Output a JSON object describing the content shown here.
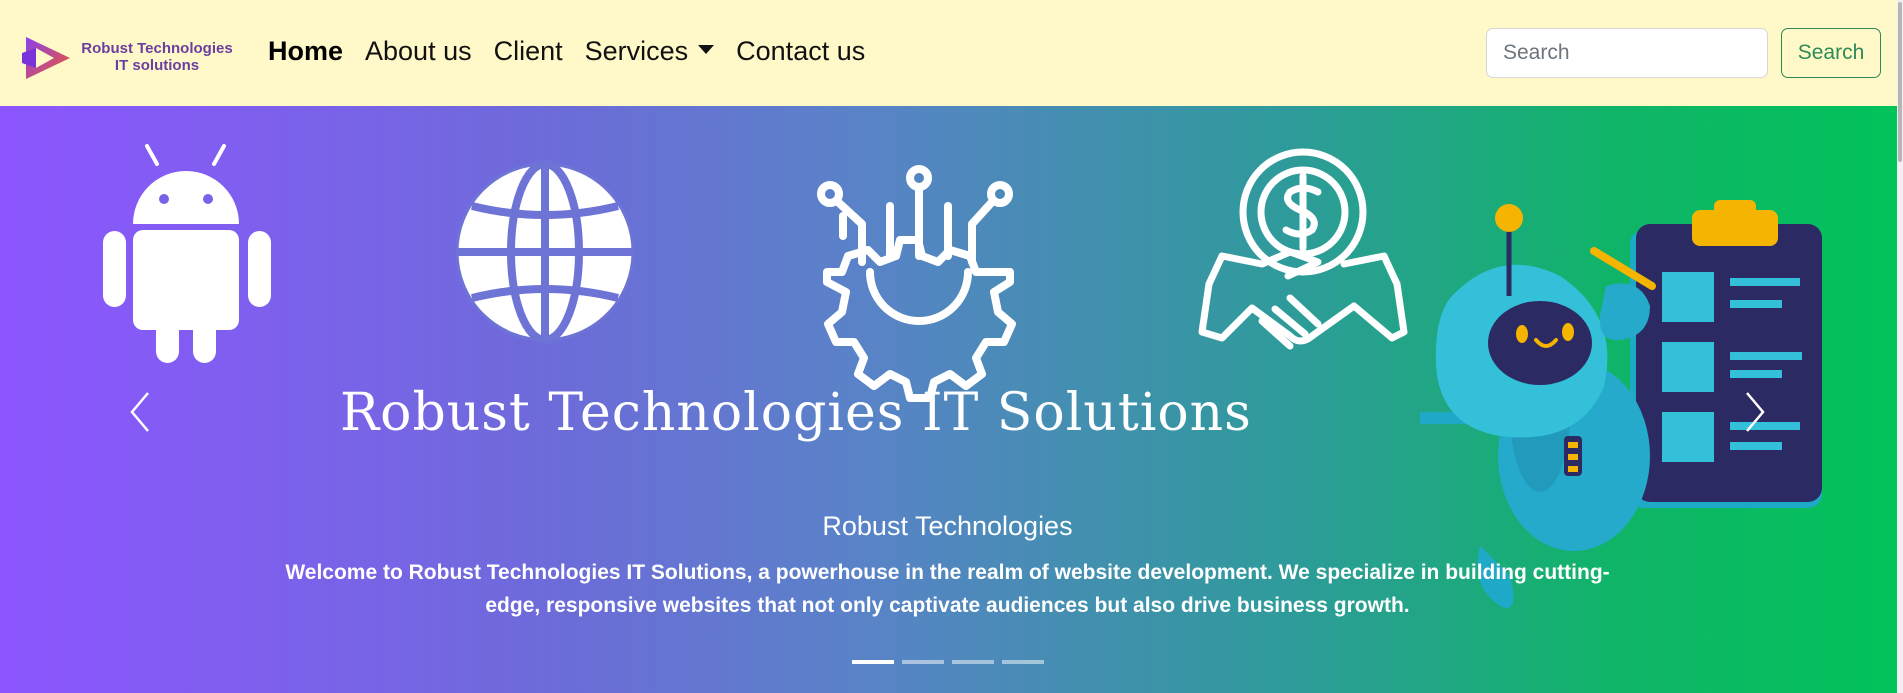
{
  "brand": {
    "name_line1": "Robust Technologies",
    "name_line2": "IT solutions",
    "colors": {
      "purple": "#6b3fa0",
      "orange": "#f05a28"
    },
    "icon": "play-logo-icon"
  },
  "nav": {
    "items": [
      {
        "label": "Home",
        "active": true
      },
      {
        "label": "About us",
        "active": false
      },
      {
        "label": "Client",
        "active": false
      },
      {
        "label": "Services",
        "active": false,
        "dropdown": true
      },
      {
        "label": "Contact us",
        "active": false
      }
    ]
  },
  "search": {
    "placeholder": "Search",
    "button_label": "Search"
  },
  "carousel": {
    "banner_title": "Robust Technologies IT Solutions",
    "caption_heading": "Robust Technologies",
    "caption_text": "Welcome to Robust Technologies IT Solutions, a powerhouse in the realm of website development. We specialize in building cutting-edge, responsive websites that not only captivate audiences but also drive business growth.",
    "slide_count": 4,
    "active_slide": 1,
    "icons": [
      "android-icon",
      "globe-icon",
      "gear-circuit-icon",
      "dollar-handshake-icon",
      "robot-checklist-illustration"
    ],
    "controls": {
      "prev_icon": "chevron-left-icon",
      "next_icon": "chevron-right-icon"
    }
  },
  "colors": {
    "navbar_bg": "#fff8c9",
    "hero_gradient_start": "#8d55ff",
    "hero_gradient_end": "#02c25a",
    "search_button": "#2e8b57"
  }
}
